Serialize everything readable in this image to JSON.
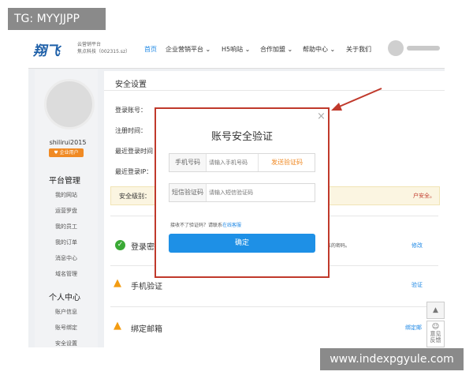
{
  "watermarks": {
    "top_left": "TG: MYYJJPP",
    "bottom_right": "www.indexpgyule.com"
  },
  "header": {
    "logo_text": "翔飞",
    "logo_sub_line1": "云营销平台",
    "logo_sub_line2": "焦点科技（002315.sz）",
    "nav": [
      {
        "label": "首页"
      },
      {
        "label": "企业营销平台 ⌄"
      },
      {
        "label": "H5响站 ⌄"
      },
      {
        "label": "合作加盟 ⌄"
      },
      {
        "label": "帮助中心 ⌄"
      },
      {
        "label": "关于我们"
      }
    ]
  },
  "sidebar": {
    "username": "shilirui2015",
    "badge": "企业用户",
    "section1_title": "平台管理",
    "section1_items": [
      "我的网站",
      "运营罗盘",
      "我的员工",
      "我的订单",
      "消息中心",
      "域名管理"
    ],
    "section2_title": "个人中心",
    "section2_items": [
      "账户信息",
      "账号绑定",
      "安全设置"
    ]
  },
  "main": {
    "title": "安全设置",
    "labels": [
      "登录账号：",
      "注册时间：",
      "最近登录时间",
      "最近登录IP："
    ],
    "level_label": "安全级别：",
    "level_tail": "户安全。",
    "rows": [
      {
        "title": "登录密",
        "desc1": "码。",
        "desc2": "5位的密码。",
        "link": "修改"
      },
      {
        "title": "手机验证",
        "link": "验证"
      },
      {
        "title": "绑定邮箱",
        "link": "绑定邮"
      }
    ],
    "back_top_icon": "▲",
    "side_btn_text": "意见\n反馈"
  },
  "modal": {
    "title": "账号安全验证",
    "close_icon": "×",
    "phone_label": "手机号码",
    "phone_placeholder": "请输入手机号码",
    "send_code": "发送验证码",
    "sms_label": "短信验证码",
    "sms_placeholder": "请输入短信验证码",
    "help_text": "接收不了验证码？请联系",
    "help_link": "在线客服",
    "confirm": "确定"
  },
  "colors": {
    "accent": "#1e90e6",
    "alert": "#c0392b",
    "warning": "#f08a24"
  }
}
